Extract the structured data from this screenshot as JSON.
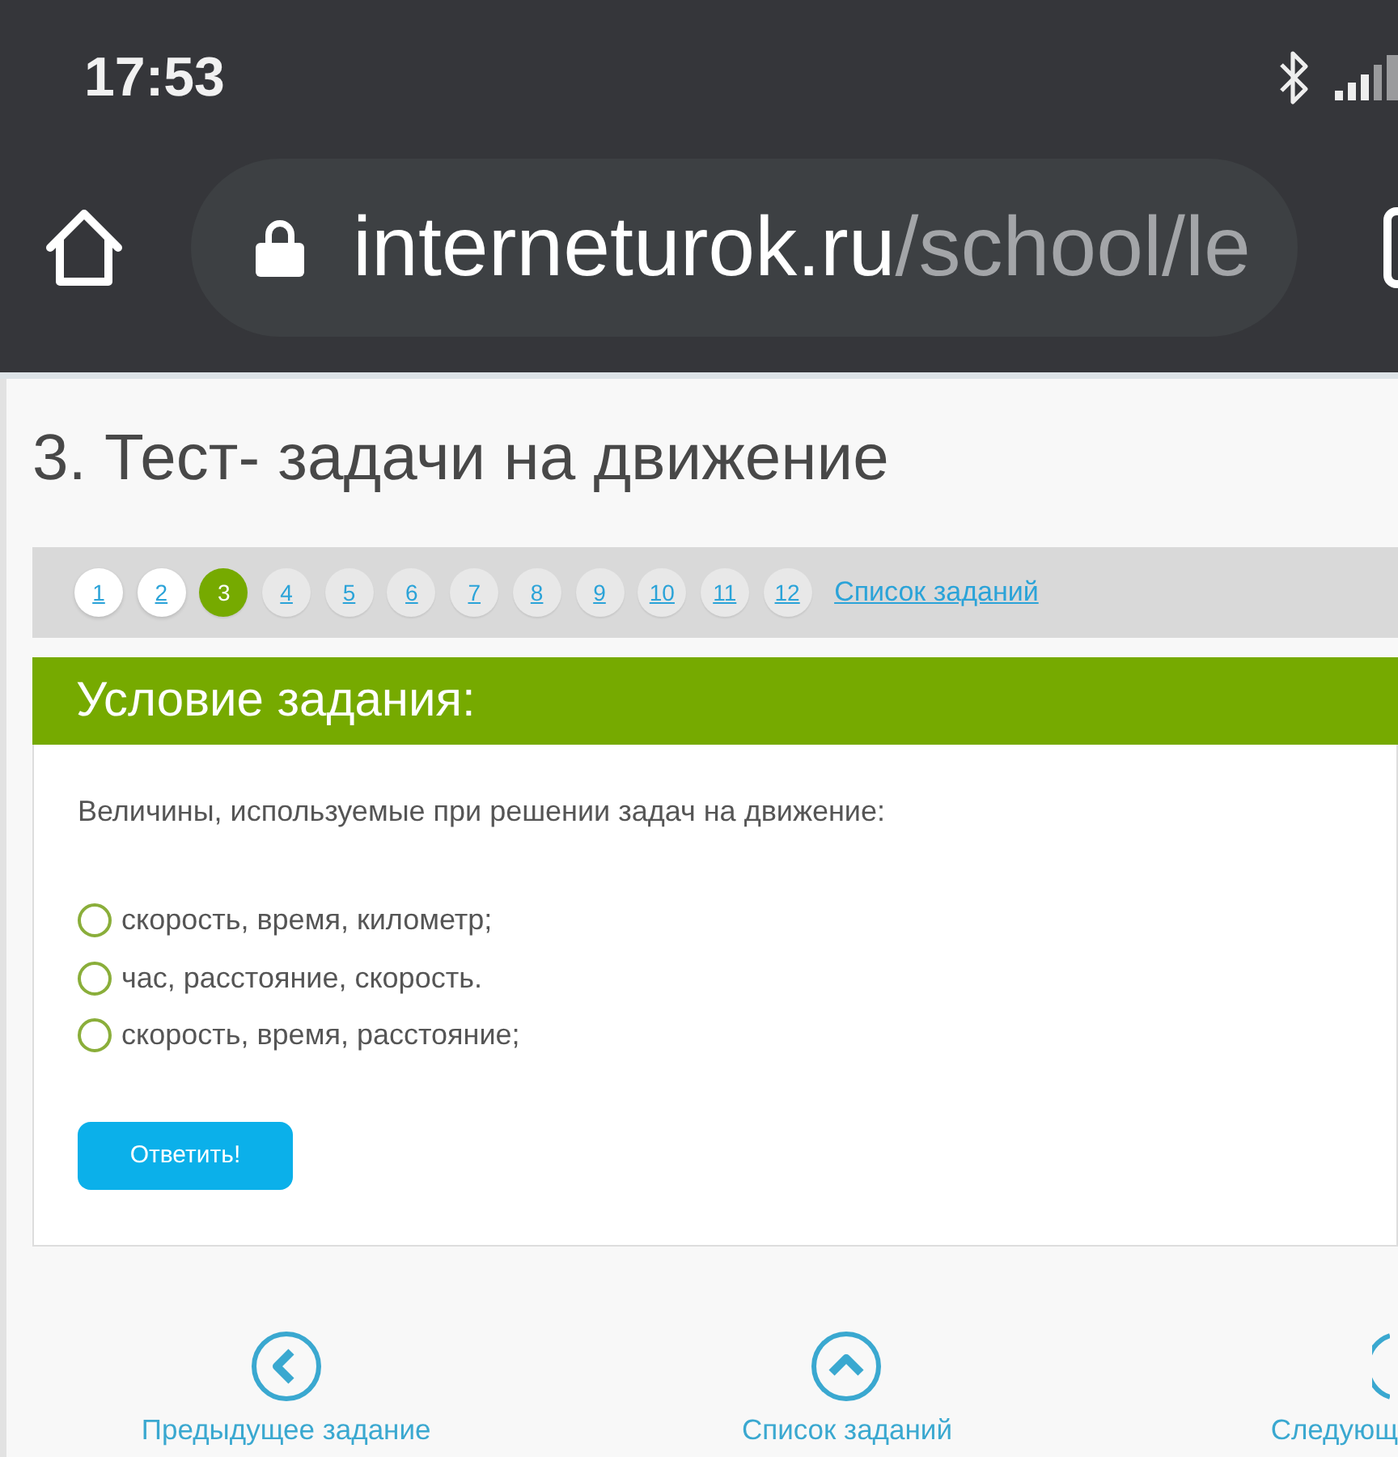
{
  "status_bar": {
    "time": "17:53"
  },
  "browser": {
    "url_host": "interneturok.ru",
    "url_path": "/school/le"
  },
  "page": {
    "title": "3. Тест- задачи на движение"
  },
  "pagination": {
    "pages": [
      {
        "label": "1",
        "selected": false,
        "visited": true
      },
      {
        "label": "2",
        "selected": false,
        "visited": true
      },
      {
        "label": "3",
        "selected": true,
        "visited": false
      },
      {
        "label": "4",
        "selected": false,
        "visited": false
      },
      {
        "label": "5",
        "selected": false,
        "visited": false
      },
      {
        "label": "6",
        "selected": false,
        "visited": false
      },
      {
        "label": "7",
        "selected": false,
        "visited": false
      },
      {
        "label": "8",
        "selected": false,
        "visited": false
      },
      {
        "label": "9",
        "selected": false,
        "visited": false
      },
      {
        "label": "10",
        "selected": false,
        "visited": false
      },
      {
        "label": "11",
        "selected": false,
        "visited": false
      },
      {
        "label": "12",
        "selected": false,
        "visited": false
      }
    ],
    "list_link": "Список заданий"
  },
  "task": {
    "header": "Условие задания:",
    "question": "Величины, используемые при решении задач на движение:",
    "options": [
      {
        "label": "скорость, время, километр;",
        "selected": false
      },
      {
        "label": "час, расстояние, скорость.",
        "selected": false
      },
      {
        "label": "скорость, время, расстояние;",
        "selected": false
      }
    ],
    "submit_button": "Ответить!"
  },
  "footer_nav": [
    {
      "kind": "previous",
      "label": "Предыдущее задание"
    },
    {
      "kind": "list",
      "label": "Список заданий"
    },
    {
      "kind": "next",
      "label": "Следующ"
    }
  ]
}
